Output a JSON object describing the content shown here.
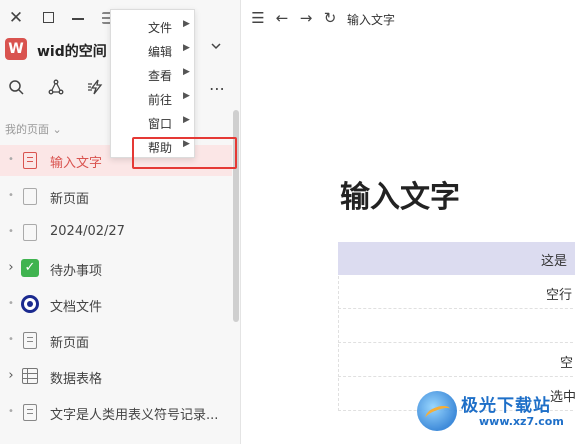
{
  "window_controls": {
    "close": "✕",
    "menu_icon": "menu-icon"
  },
  "space": {
    "avatar_letter": "W",
    "name": "wid的空间",
    "chevron": "⌄",
    "avatar_color": "#d9534f"
  },
  "toolbar": {
    "more": "⋯"
  },
  "sidebar": {
    "section_title": "我的页面 ⌄",
    "items": [
      {
        "label": "输入文字",
        "icon": "doc-icon",
        "active": true
      },
      {
        "label": "新页面",
        "icon": "blank-doc-icon"
      },
      {
        "label": "2024/02/27",
        "icon": "blank-doc-icon"
      },
      {
        "label": "待办事项",
        "icon": "checkbox-icon",
        "expandable": true
      },
      {
        "label": "文档文件",
        "icon": "eye-icon"
      },
      {
        "label": "新页面",
        "icon": "doc-icon"
      },
      {
        "label": "数据表格",
        "icon": "table-icon",
        "expandable": true
      },
      {
        "label": "文字是人类用表义符号记录...",
        "icon": "doc-icon"
      }
    ]
  },
  "context_menu": {
    "items": [
      {
        "label": "文件"
      },
      {
        "label": "编辑"
      },
      {
        "label": "查看"
      },
      {
        "label": "前往"
      },
      {
        "label": "窗口"
      },
      {
        "label": "帮助",
        "highlighted": true
      }
    ],
    "highlight_color": "#e53935"
  },
  "main": {
    "breadcrumb": "输入文字",
    "title": "输入文字",
    "table": {
      "header": "这是",
      "rows": [
        "空行",
        "",
        "空",
        "选中"
      ]
    }
  },
  "watermark": {
    "name": "极光下载站",
    "url": "www.xz7.com"
  },
  "colors": {
    "accent": "#d9534f",
    "active_bg": "#fbe6e6",
    "table_header_bg": "#dcdcf0"
  }
}
